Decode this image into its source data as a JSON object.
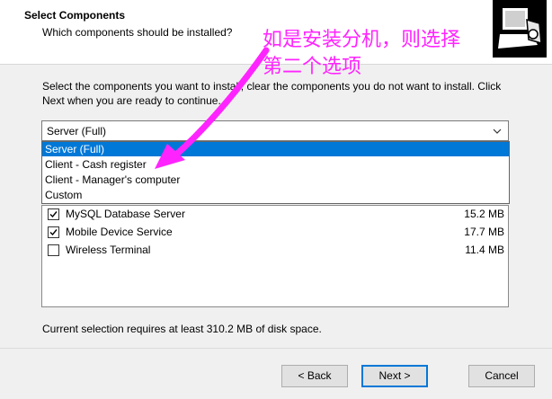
{
  "header": {
    "title": "Select Components",
    "subtitle": "Which components should be installed?",
    "icon": "installer-computer-icon"
  },
  "annotation": {
    "line1": "如是安装分机，则选择",
    "line2": "第二个选项",
    "color": "#ff24ff"
  },
  "instructions": "Select the components you want to install; clear the components you do not want to install. Click Next when you are ready to continue.",
  "combo": {
    "value": "Server (Full)",
    "options": [
      "Server (Full)",
      "Client - Cash register",
      "Client - Manager's computer",
      "Custom"
    ]
  },
  "components": [
    {
      "label": "MySQL Database Server",
      "size": "15.2 MB",
      "checked": true
    },
    {
      "label": "Mobile Device Service",
      "size": "17.7 MB",
      "checked": true
    },
    {
      "label": "Wireless Terminal",
      "size": "11.4 MB",
      "checked": false
    }
  ],
  "disk_space": "Current selection requires at least 310.2 MB of disk space.",
  "buttons": {
    "back": "< Back",
    "next": "Next >",
    "cancel": "Cancel"
  },
  "colors": {
    "selection": "#0078d7",
    "annotation": "#ff24ff"
  }
}
